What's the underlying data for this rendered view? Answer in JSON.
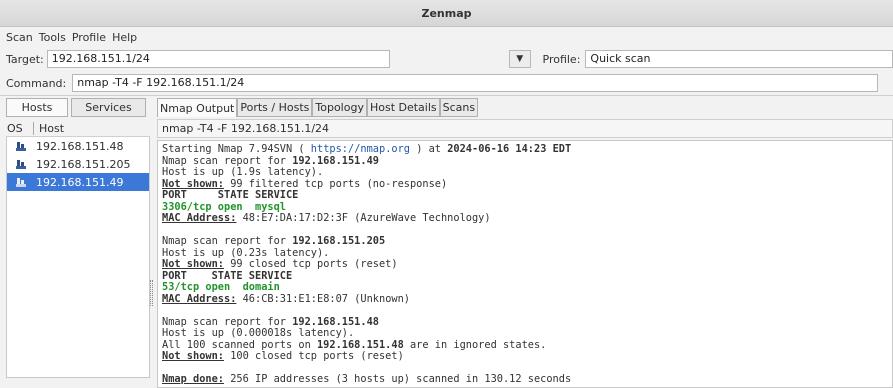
{
  "window": {
    "title": "Zenmap"
  },
  "menu": [
    "Scan",
    "Tools",
    "Profile",
    "Help"
  ],
  "target": {
    "label": "Target:",
    "value": "192.168.151.1/24"
  },
  "profile": {
    "label": "Profile:",
    "value": "Quick scan"
  },
  "command": {
    "label": "Command:",
    "value": "nmap -T4 -F 192.168.151.1/24"
  },
  "left_tabs": {
    "hosts": "Hosts",
    "services": "Services"
  },
  "host_columns": {
    "os": "OS",
    "host": "Host"
  },
  "hosts": [
    "192.168.151.48",
    "192.168.151.205",
    "192.168.151.49"
  ],
  "selected_host_index": 2,
  "output_tabs": [
    "Nmap Output",
    "Ports / Hosts",
    "Topology",
    "Host Details",
    "Scans"
  ],
  "output_command": "nmap -T4 -F 192.168.151.1/24",
  "output": {
    "l1_a": "Starting Nmap 7.94SVN ( ",
    "l1_url": "https://nmap.org",
    "l1_b": " ) at ",
    "l1_date": "2024-06-16 14:23 EDT",
    "r1_a": "Nmap scan report for ",
    "r1_ip": "192.168.151.49",
    "r1_up": "Host is up (1.9s latency).",
    "r1_ns_label": "Not shown:",
    "r1_ns": " 99 filtered tcp ports (no-response)",
    "r1_hdr": "PORT     STATE SERVICE",
    "r1_port": "3306/tcp open  mysql",
    "r1_mac_label": "MAC Address:",
    "r1_mac": " 48:E7:DA:17:D2:3F (AzureWave Technology)",
    "r2_a": "Nmap scan report for ",
    "r2_ip": "192.168.151.205",
    "r2_up": "Host is up (0.23s latency).",
    "r2_ns_label": "Not shown:",
    "r2_ns": " 99 closed tcp ports (reset)",
    "r2_hdr": "PORT    STATE SERVICE",
    "r2_port": "53/tcp open  domain",
    "r2_mac_label": "MAC Address:",
    "r2_mac": " 46:CB:31:E1:E8:07 (Unknown)",
    "r3_a": "Nmap scan report for ",
    "r3_ip": "192.168.151.48",
    "r3_up": "Host is up (0.000018s latency).",
    "r3_all_a": "All 100 scanned ports on ",
    "r3_all_ip": "192.168.151.48",
    "r3_all_b": " are in ignored states.",
    "r3_ns_label": "Not shown:",
    "r3_ns": " 100 closed tcp ports (reset)",
    "done_label": "Nmap done:",
    "done": " 256 IP addresses (3 hosts up) scanned in 130.12 seconds"
  },
  "colors": {
    "selection": "#3b78d8",
    "port_green": "#21952b",
    "link": "#2457a8"
  },
  "icons": {
    "dropdown": "chevron-down-icon",
    "os": "os-icon"
  }
}
